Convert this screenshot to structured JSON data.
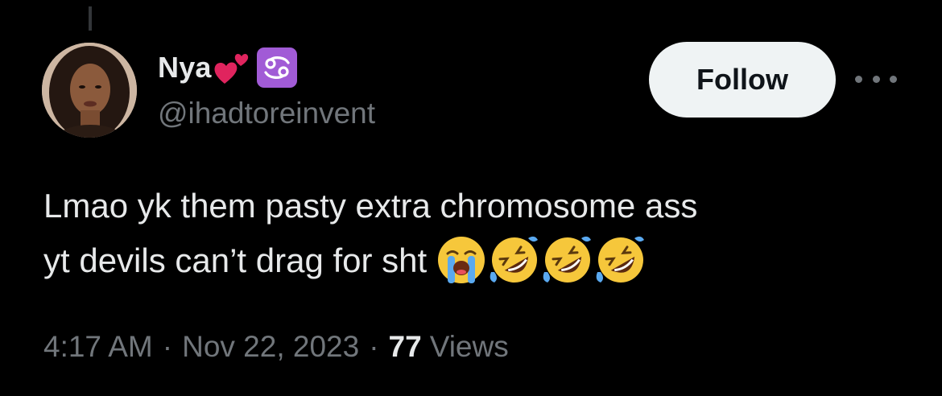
{
  "tweet": {
    "author": {
      "display_name": "Nya",
      "handle": "@ihadtoreinvent",
      "name_badges": [
        "two-hearts-icon",
        "cancer-zodiac-icon"
      ]
    },
    "follow_label": "Follow",
    "text_line_1": "Lmao yk them pasty extra chromosome ass",
    "text_line_2": "yt devils can’t drag for sht",
    "text_emojis": [
      "loudly-crying-face-icon",
      "rolling-on-floor-laughing-icon",
      "rolling-on-floor-laughing-icon",
      "rolling-on-floor-laughing-icon"
    ],
    "time": "4:17 AM",
    "separator": "·",
    "date": "Nov 22, 2023",
    "views_count": "77",
    "views_label": "Views"
  },
  "colors": {
    "background": "#000000",
    "primary_text": "#e7e9ea",
    "secondary_text": "#71767b",
    "follow_button_bg": "#eff3f4",
    "follow_button_text": "#0f1419",
    "zodiac_badge": "#a15bd6",
    "heart": "#e0245e"
  }
}
